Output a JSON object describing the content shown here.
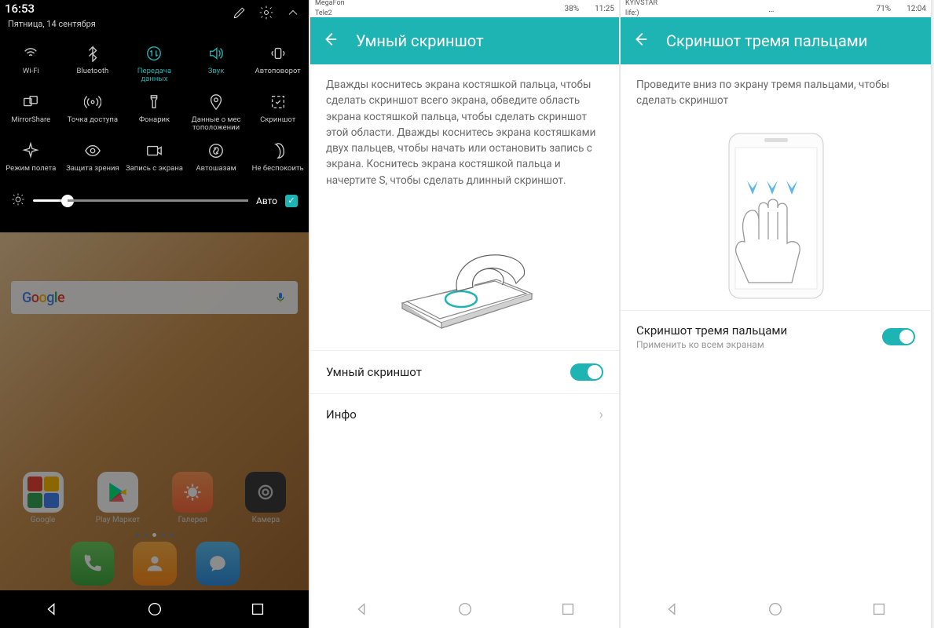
{
  "p1": {
    "time": "16:53",
    "date": "Пятница, 14 сентября",
    "tiles": [
      {
        "name": "wifi-icon",
        "label": "Wi-Fi",
        "active": false
      },
      {
        "name": "bluetooth-icon",
        "label": "Bluetooth",
        "active": false
      },
      {
        "name": "data-icon",
        "label": "Передача данных",
        "active": true
      },
      {
        "name": "sound-icon",
        "label": "Звук",
        "active": true
      },
      {
        "name": "autorotate-icon",
        "label": "Автоповорот",
        "active": false
      },
      {
        "name": "mirrorshare-icon",
        "label": "MirrorShare",
        "active": false
      },
      {
        "name": "hotspot-icon",
        "label": "Точка доступа",
        "active": false
      },
      {
        "name": "flashlight-icon",
        "label": "Фонарик",
        "active": false
      },
      {
        "name": "location-icon",
        "label": "Данные о мес тоположении",
        "active": false
      },
      {
        "name": "screenshot-icon",
        "label": "Скриншот",
        "active": false
      },
      {
        "name": "airplane-icon",
        "label": "Режим полета",
        "active": false
      },
      {
        "name": "eye-icon",
        "label": "Защита зрения",
        "active": false
      },
      {
        "name": "screenrec-icon",
        "label": "Запись с экрана",
        "active": false
      },
      {
        "name": "shazam-icon",
        "label": "Автошазам",
        "active": false
      },
      {
        "name": "dnd-icon",
        "label": "Не беспокоить",
        "active": false
      }
    ],
    "auto_label": "Авто",
    "search_label": "Google",
    "apps": [
      {
        "label": "Google"
      },
      {
        "label": "Play Маркет"
      },
      {
        "label": "Галерея"
      },
      {
        "label": "Камера"
      }
    ]
  },
  "p2": {
    "carrier1": "MegaFon",
    "carrier2": "Tele2",
    "battery": "38%",
    "time": "11:25",
    "title": "Умный скриншот",
    "desc": "Дважды коснитесь экрана костяшкой пальца, чтобы сделать скриншот всего экрана, обведите область экрана костяшкой пальца, чтобы сделать скриншот этой области. Дважды коснитесь экрана костяшками двух пальцев, чтобы начать или остановить запись с экрана. Коснитесь экрана костяшкой пальца и начертите S, чтобы сделать длинный скриншот.",
    "toggle_label": "Умный скриншот",
    "info_label": "Инфо"
  },
  "p3": {
    "carrier": "KYIVSTAR",
    "carrier2": "life:)",
    "battery": "71%",
    "time": "12:04",
    "title": "Скриншот тремя пальцами",
    "desc": "Проведите вниз по экрану тремя пальцами, чтобы сделать скриншот",
    "toggle_label": "Скриншот тремя пальцами",
    "toggle_sub": "Применить ко всем экранам"
  }
}
